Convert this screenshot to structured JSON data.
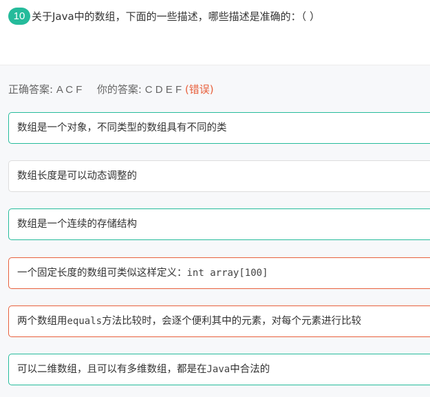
{
  "question": {
    "number": "10",
    "text": "关于Java中的数组，下面的一些描述，哪些描述是准确的：（    ）"
  },
  "answer": {
    "correct_label": "正确答案:",
    "correct_value": "A C F",
    "yours_label": "你的答案:",
    "yours_value": "C D E F",
    "status": "(错误)"
  },
  "colors": {
    "accent": "#25bb9b",
    "error": "#e8603c"
  },
  "options": [
    {
      "text": "数组是一个对象，不同类型的数组具有不同的类",
      "state": "correct"
    },
    {
      "text": "数组长度是可以动态调整的",
      "state": "neutral"
    },
    {
      "text": "数组是一个连续的存储结构",
      "state": "correct"
    },
    {
      "text_before": "一个固定长度的数组可类似这样定义：",
      "code": "int array[100]",
      "text_after": "",
      "state": "incorrect"
    },
    {
      "text_before": "两个数组用",
      "code": "equals",
      "text_after": "方法比较时，会逐个便利其中的元素，对每个元素进行比较",
      "state": "incorrect"
    },
    {
      "text_before": "可以二维数组，且可以有多维数组，都是在",
      "code": "Java",
      "text_after": "中合法的",
      "state": "correct"
    }
  ]
}
